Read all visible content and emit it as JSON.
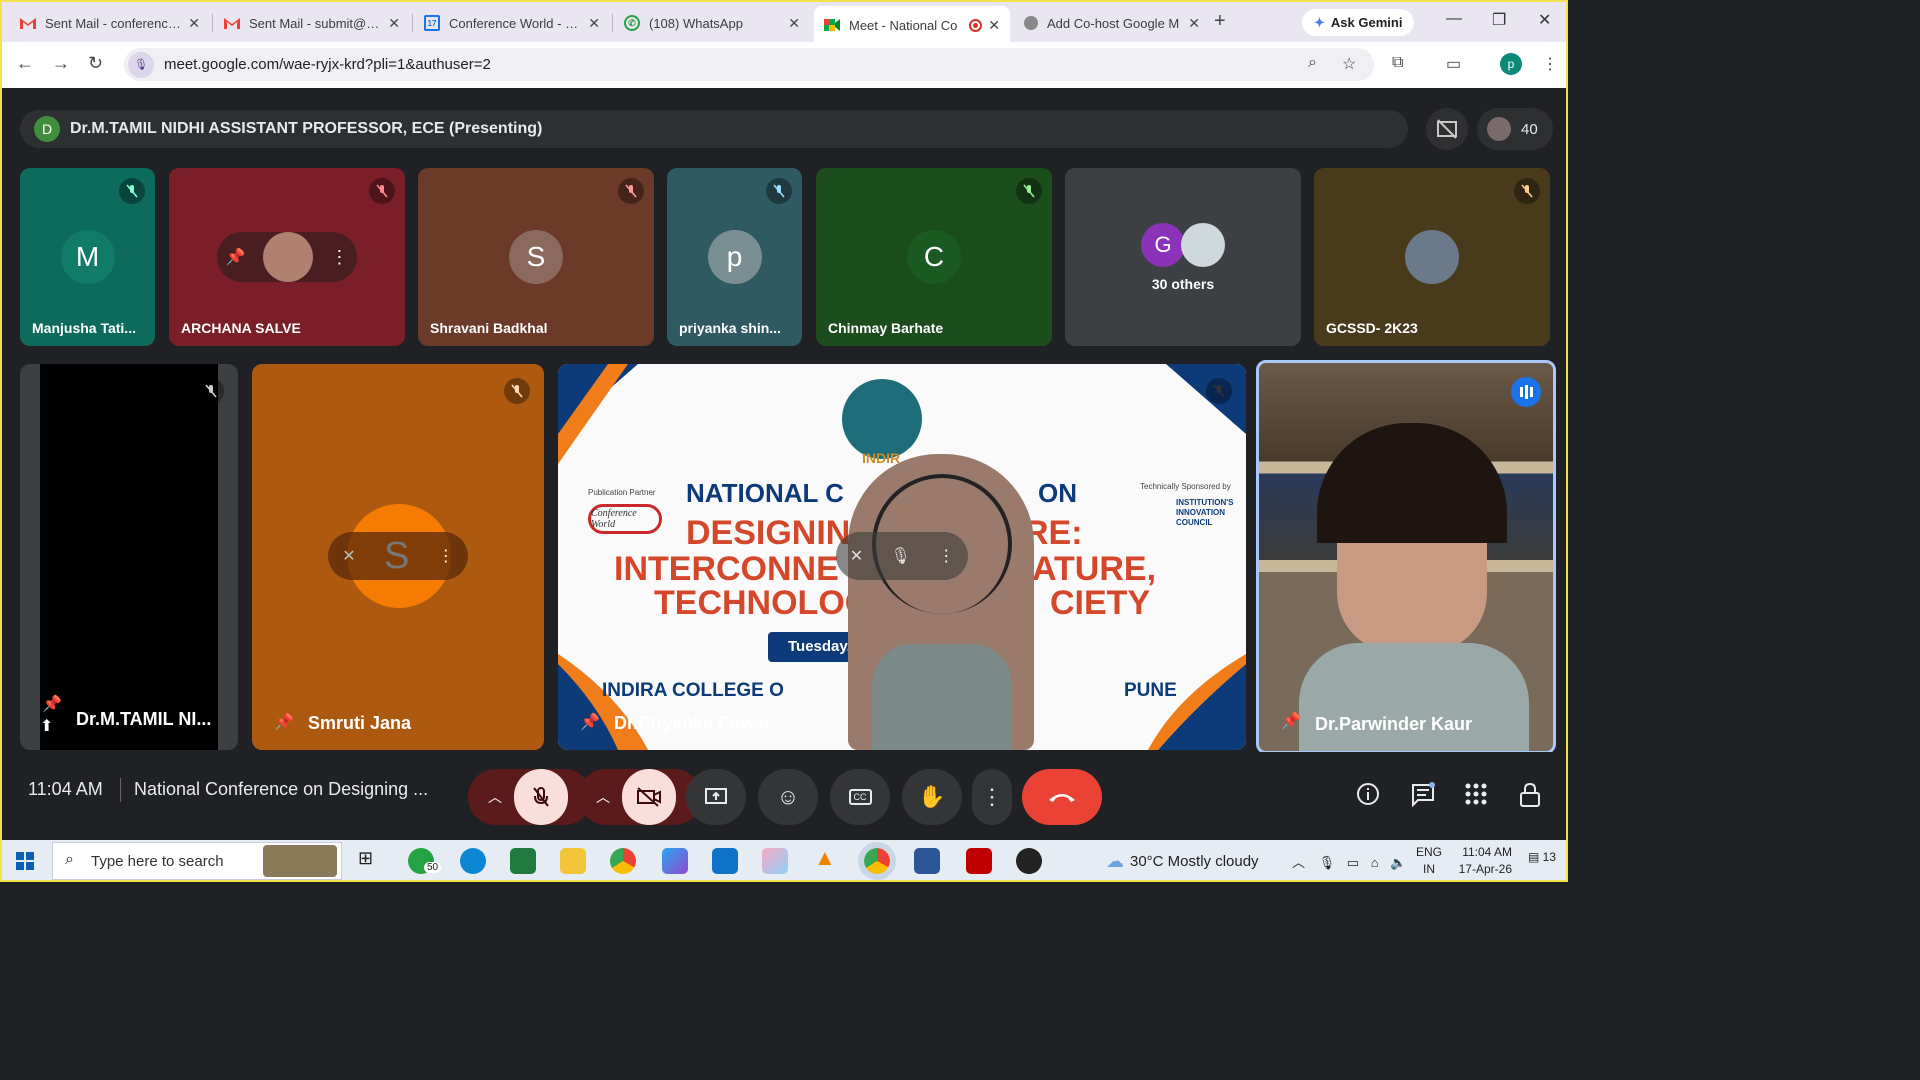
{
  "browser": {
    "tabs": [
      {
        "title": "Sent Mail - conferencew",
        "icon": "gmail-icon"
      },
      {
        "title": "Sent Mail - submit@con",
        "icon": "gmail-icon"
      },
      {
        "title": "Conference World - Cal",
        "icon": "calendar-icon"
      },
      {
        "title": "(108) WhatsApp",
        "icon": "whatsapp-icon"
      },
      {
        "title": "Meet - National Co",
        "icon": "meet-icon"
      },
      {
        "title": "Add Co-host Google M",
        "icon": "chrome-icon"
      }
    ],
    "gemini_label": "Ask Gemini",
    "url": "meet.google.com/wae-ryjx-krd?pli=1&authuser=2",
    "profile_initial": "p"
  },
  "meet": {
    "presenter": {
      "initial": "D",
      "text": "Dr.M.TAMIL NIDHI ASSISTANT PROFESSOR, ECE (Presenting)"
    },
    "participant_count": "40",
    "top_tiles": [
      {
        "name": "Manjusha Tati...",
        "initial": "M",
        "bg": "#0d6b5e",
        "avatar": "#117a68"
      },
      {
        "name": "ARCHANA SALVE",
        "initial": "",
        "bg": "#7a1f28",
        "avatar": ""
      },
      {
        "name": "Shravani Badkhal",
        "initial": "S",
        "bg": "#6b3a28",
        "avatar": "#8a6a5c"
      },
      {
        "name": "priyanka shin...",
        "initial": "p",
        "bg": "#2f5a63",
        "avatar": "#7a8f93"
      },
      {
        "name": "Chinmay Barhate",
        "initial": "C",
        "bg": "#1c4d1c",
        "avatar": "#1c5a24"
      },
      {
        "name": "30 others",
        "initial": "G",
        "bg": "#3c4043",
        "avatar": "#8b32b8"
      },
      {
        "name": "GCSSD- 2K23",
        "initial": "",
        "bg": "#4a3a1c",
        "avatar": ""
      }
    ],
    "big_tiles": [
      {
        "name": "Dr.M.TAMIL NI..."
      },
      {
        "name": "Smruti Jana",
        "initial": "S"
      },
      {
        "name": "Dr.Priyanka Pawar"
      },
      {
        "name": "Dr.Parwinder Kaur"
      }
    ],
    "slide": {
      "line1": "NATIONAL C",
      "line1b": "ON",
      "line2": "DESIGNIN",
      "line2b": "RE:",
      "line3": "INTERCONNE",
      "line3b": "ATURE,",
      "line4": "TECHNOLOG",
      "line4b": "CIETY",
      "date": "Tuesday, 1",
      "college": "INDIRA COLLEGE O",
      "city": "PUNE",
      "partner": "Publication Partner",
      "partner_name": "Conference World",
      "sponsor": "Technically Sponsored by",
      "sponsor_name": "INSTITUTION'S INNOVATION COUNCIL",
      "logo_text": "INDIR"
    },
    "time": "11:04 AM",
    "meeting_title": "National Conference on Designing ..."
  },
  "taskbar": {
    "search_placeholder": "Type here to search",
    "whatsapp_badge": "50",
    "weather": "30°C  Mostly cloudy",
    "lang1": "ENG",
    "lang2": "IN",
    "time": "11:04 AM",
    "date": "17-Apr-26",
    "notifications": "13"
  }
}
